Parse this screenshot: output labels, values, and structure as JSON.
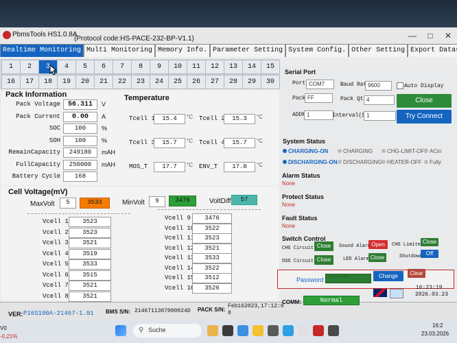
{
  "app": {
    "title": "PbmsTools HS1.0.8A",
    "protocol": "(Protocol code:HS-PACE-232-BP-V1.1)"
  },
  "tabs": [
    "Realtime Monitoring",
    "Multi Monitoring",
    "Memory Info.",
    "Parameter Setting",
    "System Config.",
    "Other Setting",
    "Export Datas"
  ],
  "cell_numbers": [
    "1",
    "2",
    "3",
    "4",
    "5",
    "6",
    "7",
    "8",
    "9",
    "10",
    "11",
    "12",
    "13",
    "14",
    "15",
    "16",
    "17",
    "18",
    "19",
    "20",
    "21",
    "22",
    "23",
    "24",
    "25",
    "26",
    "27",
    "28",
    "29",
    "30"
  ],
  "pack": {
    "header": "Pack Information",
    "rows": [
      {
        "label": "Pack Voltage",
        "value": "56.311",
        "unit": "V"
      },
      {
        "label": "Pack Current",
        "value": "0.00",
        "unit": "A"
      },
      {
        "label": "SOC",
        "value": "100",
        "unit": "%"
      },
      {
        "label": "SOH",
        "value": "100",
        "unit": "%"
      },
      {
        "label": "RemainCapacity",
        "value": "249180",
        "unit": "mAH"
      },
      {
        "label": "FullCapacity",
        "value": "250000",
        "unit": "mAH"
      },
      {
        "label": "Battery Cycle",
        "value": "168",
        "unit": ""
      }
    ]
  },
  "temperature": {
    "header": "Temperature",
    "rows": [
      {
        "label": "Tcell 1",
        "value": "15.4"
      },
      {
        "label": "Tcell 2",
        "value": "15.3"
      },
      {
        "label": "Tcell 3",
        "value": "15.7"
      },
      {
        "label": "Tcell 4",
        "value": "15.7"
      },
      {
        "label": "MOS_T",
        "value": "17.7"
      },
      {
        "label": "ENV_T",
        "value": "17.0"
      }
    ],
    "unit_glyph": "°C"
  },
  "cell_voltage": {
    "header": "Cell Voltage(mV)",
    "max_label": "MaxVolt",
    "max_cell": "5",
    "max_value": "3533",
    "min_label": "MinVolt",
    "min_cell": "9",
    "min_value": "3476",
    "diff_label": "VoltDiff",
    "diff_value": "57",
    "left": [
      {
        "label": "Vcell 1",
        "value": "3523"
      },
      {
        "label": "Vcell 2",
        "value": "3523"
      },
      {
        "label": "Vcell 3",
        "value": "3521"
      },
      {
        "label": "Vcell 4",
        "value": "3519"
      },
      {
        "label": "Vcell 5",
        "value": "3533"
      },
      {
        "label": "Vcell 6",
        "value": "3515"
      },
      {
        "label": "Vcell 7",
        "value": "3521"
      },
      {
        "label": "Vcell 8",
        "value": "3521"
      }
    ],
    "right": [
      {
        "label": "Vcell 9",
        "value": "3476"
      },
      {
        "label": "Vcell 10",
        "value": "3522"
      },
      {
        "label": "Vcell 11",
        "value": "3523"
      },
      {
        "label": "Vcell 12",
        "value": "3521"
      },
      {
        "label": "Vcell 13",
        "value": "3533"
      },
      {
        "label": "Vcell 14",
        "value": "3522"
      },
      {
        "label": "Vcell 15",
        "value": "3512"
      },
      {
        "label": "Vcell 16",
        "value": "3526"
      }
    ]
  },
  "serial": {
    "header": "Serial Port",
    "port_label": "Port",
    "port_value": "COM7",
    "baud_label": "Baud Rate",
    "baud_value": "9600",
    "auto_display": "Auto Display",
    "pack_label": "Pack",
    "pack_value": "FF",
    "packqty_label": "Pack Qty",
    "packqty_value": "4",
    "addr_label": "ADDR",
    "addr_value": "1",
    "interval_label": "Interval(S)",
    "interval_value": "1",
    "close_btn": "Close",
    "try_btn": "Try Connect"
  },
  "system_status": {
    "header": "System Status",
    "items": [
      "CHARGING-ON",
      "CHARGING",
      "CHG-LIMIT-OFF",
      "ACin",
      "DISCHARGING-ON",
      "DISCHARGING",
      "HEATER-OFF",
      "Fully"
    ]
  },
  "alarm": {
    "header": "Alarm Status",
    "value": "None"
  },
  "protect": {
    "header": "Protect Status",
    "value": "None"
  },
  "fault": {
    "header": "Fault Status",
    "value": "None"
  },
  "switch": {
    "header": "Switch Control",
    "chg_circuit": "CHG Circuit",
    "chg_btn": "Close",
    "sound_alarm": "Sound Alarm",
    "sound_btn": "Open",
    "chg_limiter": "CHG Limiter",
    "limiter_btn": "Close",
    "dsg_circuit": "DSG Circuit",
    "dsg_btn": "Close",
    "led_alarm": "LED Alarm",
    "led_btn": "Close",
    "shutdown": "Shutdown",
    "shutdown_btn": "Off"
  },
  "password": {
    "label": "Password",
    "value": "******",
    "change_btn": "Change",
    "clear_btn": "Clear"
  },
  "statusbar": {
    "ver_label": "VER:",
    "ver_value": "P16S100A-21467-1.01",
    "bms_label": "BMS S/N:",
    "bms_value": "2146711307000024D",
    "pack_label": "PACK S/N:",
    "pack_value": "Feb162023,17:12:0",
    "pack_value2": "8",
    "comm_label": "COMM:",
    "comm_value": "Normal",
    "time": "16:23:19",
    "date": "2026.03.23"
  },
  "taskbar": {
    "search": "Suche",
    "clock_time": "16:2",
    "clock_date": "23.03.2026",
    "left_text1": "V0",
    "left_text2": "-0,21%"
  },
  "colors": {
    "accent": "#1565c0",
    "orange": "#f57c00",
    "green": "#2e7d32",
    "teal": "#26a69a",
    "red": "#c62828"
  }
}
